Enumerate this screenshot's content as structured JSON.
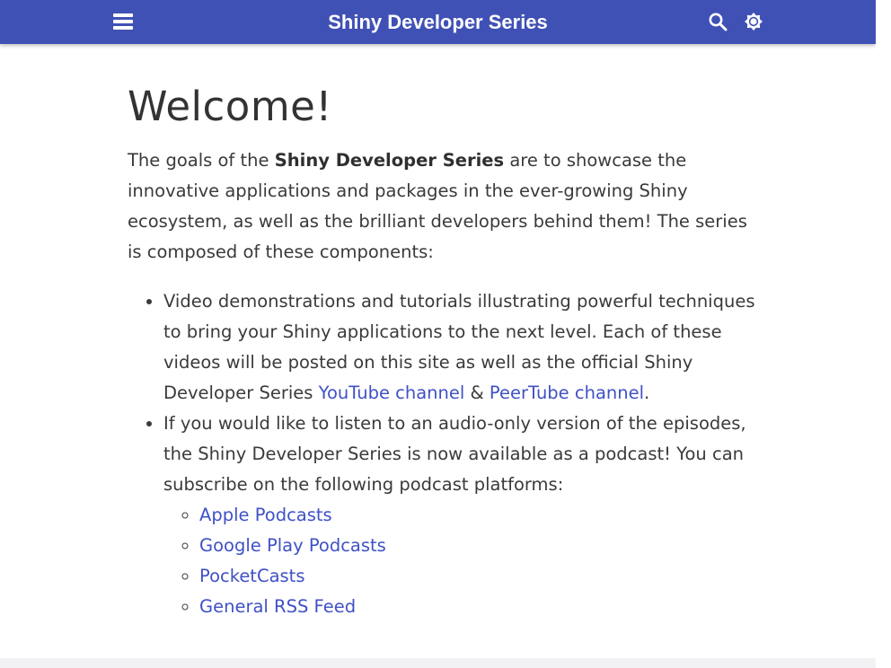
{
  "header": {
    "title": "Shiny Developer Series",
    "menu_icon": "menu-icon",
    "search_icon": "search-icon",
    "theme_icon": "brightness-icon",
    "bar_color": "#4051b5"
  },
  "main": {
    "heading": "Welcome!",
    "intro": {
      "before": "The goals of the ",
      "bold": "Shiny Developer Series",
      "after": " are to showcase the innovative applications and packages in the ever-growing Shiny ecosystem, as well as the brilliant developers behind them! The series is composed of these components:"
    },
    "bullets": [
      {
        "text": "Video demonstrations and tutorials illustrating powerful techniques to bring your Shiny applications to the next level. Each of these videos will be posted on this site as well as the official Shiny Developer Series ",
        "link1": "YouTube channel",
        "amp": " & ",
        "link2": "PeerTube channel",
        "end": "."
      },
      {
        "text": "If you would like to listen to an audio-only version of the episodes, the Shiny Developer Series is now available as a podcast! You can subscribe on the following podcast platforms:"
      }
    ],
    "podcasts": [
      "Apple Podcasts",
      "Google Play Podcasts",
      "PocketCasts",
      "General RSS Feed"
    ],
    "link_color": "#3f51c5"
  }
}
